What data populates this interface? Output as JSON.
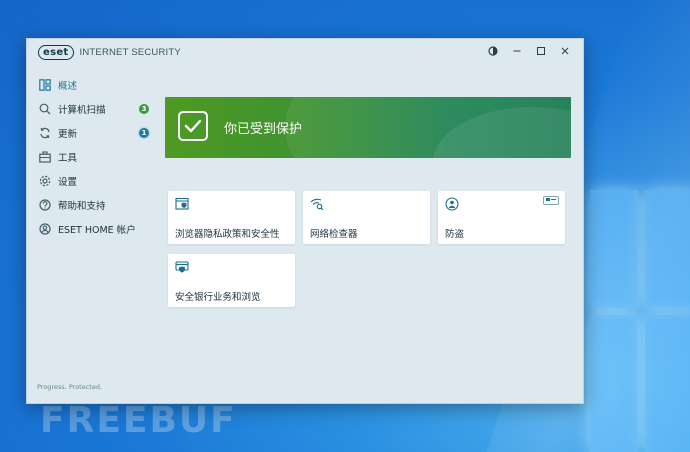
{
  "app": {
    "logo_mark": "eset",
    "product_name": "INTERNET SECURITY"
  },
  "titlebar": {
    "icons": [
      "theme-toggle-icon",
      "minimize-icon",
      "maximize-icon",
      "close-icon"
    ]
  },
  "sidebar": {
    "items": [
      {
        "label": "概述",
        "icon": "overview-icon",
        "active": true
      },
      {
        "label": "计算机扫描",
        "icon": "search-icon",
        "badge": "3",
        "badge_color": "#3b9a3e"
      },
      {
        "label": "更新",
        "icon": "refresh-icon",
        "badge": "1",
        "badge_color": "#1e7aa8"
      },
      {
        "label": "工具",
        "icon": "toolbox-icon"
      },
      {
        "label": "设置",
        "icon": "gear-icon"
      },
      {
        "label": "帮助和支持",
        "icon": "help-icon"
      },
      {
        "label": "ESET HOME 帐户",
        "icon": "account-icon"
      }
    ],
    "footer": "Progress. Protected."
  },
  "hero": {
    "status_text": "你已受到保护",
    "colors": {
      "start": "#4e9a22",
      "end": "#16794f"
    }
  },
  "cards": [
    {
      "label": "浏览器隐私政策和安全性",
      "icon": "browser-shield-icon"
    },
    {
      "label": "网络检查器",
      "icon": "wifi-search-icon"
    },
    {
      "label": "防盗",
      "icon": "anti-theft-icon",
      "tag": "icon-tag"
    },
    {
      "label": "安全银行业务和浏览",
      "icon": "bank-card-shield-icon"
    }
  ],
  "desktop": {
    "watermark": "FREEBUF"
  }
}
